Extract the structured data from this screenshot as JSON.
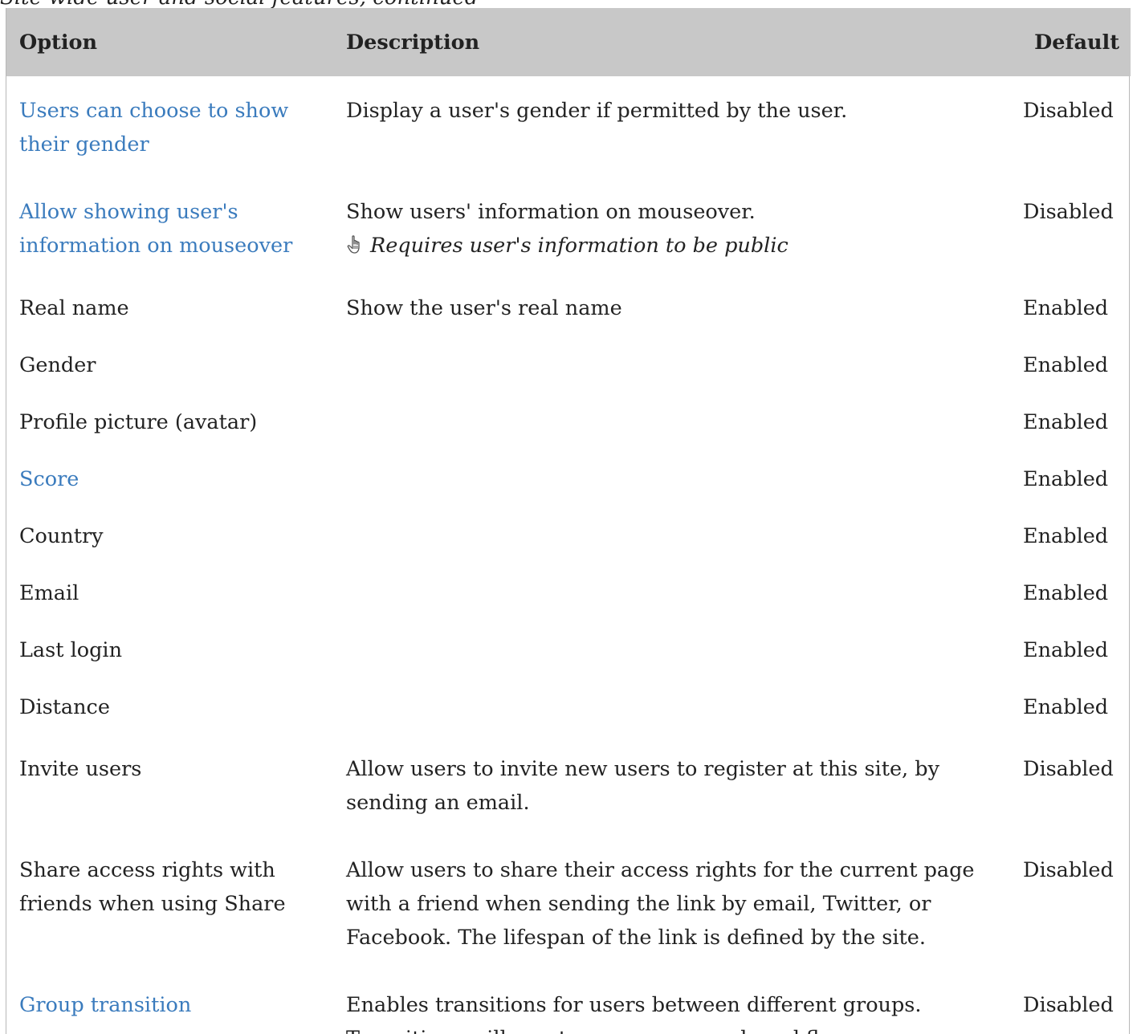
{
  "caption": "Site-wide user and social features, continued",
  "table": {
    "headers": {
      "option": "Option",
      "description": "Description",
      "default": "Default"
    },
    "rows": [
      {
        "option": "Users can choose to show their gender",
        "option_is_link": true,
        "description": "Display a user's gender if permitted by the user.",
        "default": "Disabled"
      },
      {
        "option": "Allow showing user's information on mouseover",
        "option_is_link": true,
        "description": "Show users' information on mouseover.",
        "note": "Requires user's information to be public",
        "note_icon": "hand-pointer-icon",
        "default": "Disabled"
      },
      {
        "option": "Real name",
        "option_is_link": false,
        "description": "Show the user's real name",
        "default": "Enabled"
      },
      {
        "option": "Gender",
        "option_is_link": false,
        "description": "",
        "default": "Enabled"
      },
      {
        "option": "Profile picture (avatar)",
        "option_is_link": false,
        "description": "",
        "default": "Enabled"
      },
      {
        "option": "Score",
        "option_is_link": true,
        "description": "",
        "default": "Enabled"
      },
      {
        "option": "Country",
        "option_is_link": false,
        "description": "",
        "default": "Enabled"
      },
      {
        "option": "Email",
        "option_is_link": false,
        "description": "",
        "default": "Enabled"
      },
      {
        "option": "Last login",
        "option_is_link": false,
        "description": "",
        "default": "Enabled"
      },
      {
        "option": "Distance",
        "option_is_link": false,
        "description": "",
        "default": "Enabled"
      },
      {
        "option": "Invite users",
        "option_is_link": false,
        "description": "Allow users to invite new users to register at this site, by sending an email.",
        "default": "Disabled"
      },
      {
        "option": "Share access rights with friends when using Share",
        "option_is_link": false,
        "description": "Allow users to share their access rights for the current page with a friend when sending the link by email, Twitter, or Facebook. The lifespan of the link is defined by the site.",
        "default": "Disabled"
      },
      {
        "option": "Group transition",
        "option_is_link": true,
        "description": "Enables transitions for users between different groups. Transitions will create a user approval workflow.",
        "default": "Disabled"
      }
    ]
  },
  "colors": {
    "link": "#3a7bbd",
    "header_bg": "#c8c8c8",
    "text": "#222222"
  }
}
